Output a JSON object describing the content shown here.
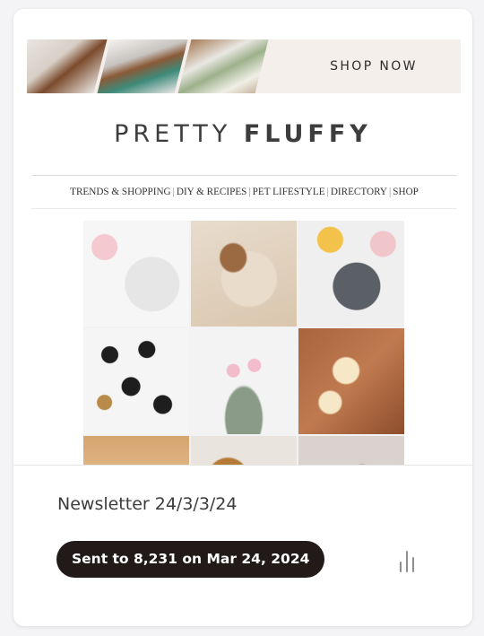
{
  "preview": {
    "banner": {
      "cta": "SHOP NOW",
      "background": "#f4efeb"
    },
    "brand": {
      "light": "PRETTY",
      "bold": "FLUFFY"
    },
    "nav": [
      "TRENDS & SHOPPING",
      "DIY & RECIPES",
      "PET LIFESTYLE",
      "DIRECTORY",
      "SHOP"
    ],
    "nav_separator": "|"
  },
  "card": {
    "title": "Newsletter 24/3/3/24",
    "status_badge": "Sent to 8,231 on Mar 24, 2024",
    "badge_color": "#211a19",
    "stats_icon": "bar-chart-icon"
  }
}
